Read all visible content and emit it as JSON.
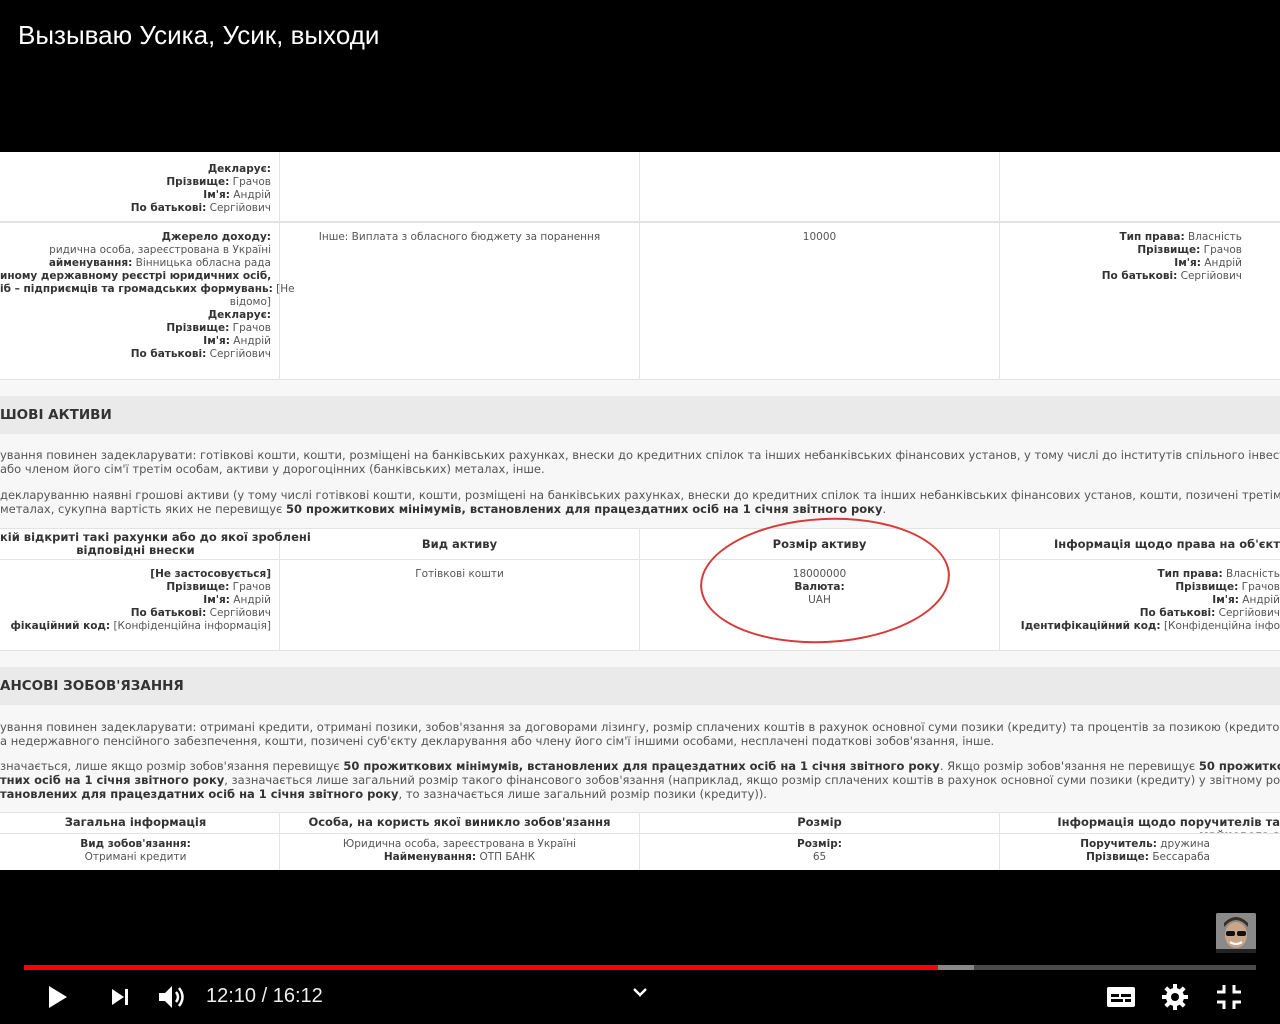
{
  "video": {
    "title": "Вызываю Усика, Усик, выходи",
    "current_time": "12:10",
    "separator": "/",
    "duration": "16:12",
    "progress_played": 0.7415,
    "progress_loaded": 0.7715
  },
  "doc": {
    "row1": {
      "c1": [
        "Декларує:",
        "Прізвище: Грачов",
        "Ім'я: Андрій",
        "По батькові: Сергійович"
      ]
    },
    "row2": {
      "c1_lines": [
        {
          "b": "Джерело доходу:",
          "t": ""
        },
        {
          "b": "",
          "t": "ридична особа, зареєстрована в Україні"
        },
        {
          "b": "айменування:",
          "t": " Вінницька обласна рада"
        },
        {
          "b": "иному державному реєстрі юридичних осіб,",
          "t": ""
        },
        {
          "b": "іб – підприємців та громадських формувань:",
          "t": " [Не"
        },
        {
          "b": "",
          "t": "відомо]"
        },
        {
          "b": "",
          "t": " "
        },
        {
          "b": "Декларує:",
          "t": ""
        },
        {
          "b": "Прізвище:",
          "t": " Грачов"
        },
        {
          "b": "Ім'я:",
          "t": " Андрій"
        },
        {
          "b": "По батькові:",
          "t": " Сергійович"
        }
      ],
      "c2": "Інше: Виплата з обласного бюджету за поранення",
      "c3": "10000",
      "c4_lines": [
        {
          "b": "Тип права:",
          "t": " Власність"
        },
        {
          "b": "Прізвище:",
          "t": " Грачов"
        },
        {
          "b": "Ім'я:",
          "t": " Андрій"
        },
        {
          "b": "По батькові:",
          "t": " Сергійович"
        }
      ]
    },
    "section_cash": "ШОВІ АКТИВИ",
    "cash_para": [
      "ування повинен задекларувати: готівкові кошти, кошти, розміщені на банківських рахунках, внески до кредитних спілок та інших небанківських фінансових установ, у тому числі до інститутів спільного інвестування, кошти, поз",
      "або членом його сім'ї третім особам, активи у дорогоцінних (банківських) металах, інше."
    ],
    "cash_para2_a": " декларуванню наявні грошові активи (у тому числі готівкові кошти, кошти, розміщені на банківських рахунках, внески до кредитних спілок та інших небанківських фінансових установ, кошти, позичені третім особам) та активи у",
    "cash_para2_b1": "металах, сукупна вартість яких не перевищує ",
    "cash_para2_b2": "50 прожиткових мінімумів, встановлених для працездатних осіб на 1 січня звітного року",
    "cash_para2_b3": ".",
    "cash_headers": {
      "c1a": "кій відкриті такі рахунки або до якої зроблені",
      "c1b": "відповідні внески",
      "c2": "Вид активу",
      "c3": "Розмір активу",
      "c4": "Інформація щодо права на об'єкт"
    },
    "cash_row": {
      "c1_lines": [
        {
          "b": "[Не застосовується]",
          "t": ""
        },
        {
          "b": "",
          "t": " "
        },
        {
          "b": "Прізвище:",
          "t": " Грачов"
        },
        {
          "b": "Ім'я:",
          "t": " Андрій"
        },
        {
          "b": "По батькові:",
          "t": " Сергійович"
        },
        {
          "b": "фікаційний код:",
          "t": " [Конфіденційна інформація]"
        }
      ],
      "c2": "Готівкові кошти",
      "c3_value": "18000000",
      "c3_currency_label": "Валюта:",
      "c3_currency": "UAH",
      "c4_lines": [
        {
          "b": "Тип права:",
          "t": " Власність"
        },
        {
          "b": "Прізвище:",
          "t": " Грачов"
        },
        {
          "b": "Ім'я:",
          "t": " Андрій"
        },
        {
          "b": "По батькові:",
          "t": " Сергійович"
        },
        {
          "b": "Ідентифікаційний код:",
          "t": " [Конфіденційна інфо"
        }
      ]
    },
    "section_liab": "АНСОВІ ЗОБОВ'ЯЗАННЯ",
    "liab_para": [
      "ування повинен задекларувати: отримані кредити, отримані позики, зобов'язання за договорами лізингу, розмір сплачених коштів в рахунок основної суми позики (кредиту) та процентів за позикою (кредитом), зобов'язання за д",
      "а недержавного пенсійного забезпечення, кошти, позичені суб'єкту декларування або члену його сім'ї іншими особами, несплачені податкові зобов'язання, інше."
    ],
    "liab_p2": [
      {
        "t": "значається, лише якщо розмір зобов'язання перевищує ",
        "b": "50 прожиткових мінімумів, встановлених для працездатних осіб на 1 січня звітного року",
        "t2": ". Якщо розмір зобов'язання не перевищує ",
        "b2": "50 прожиткових мінімумів"
      },
      {
        "t": "",
        "b": "тних осіб на 1 січня звітного року",
        "t2": ", зазначається лише загальний розмір такого фінансового зобов'язання (наприклад, якщо розмір сплачених коштів в рахунок основної суми позики (кредиту) у звітному році не перевищує ",
        "b2": "50"
      },
      {
        "t": "",
        "b": "тановлених для працездатних осіб на 1 січня звітного року",
        "t2": ", то зазначається лише загальний розмір позики (кредиту)).",
        "b2": ""
      }
    ],
    "liab_headers": {
      "c1": "Загальна інформація",
      "c2": "Особа, на користь якої виникло зобов'язання",
      "c3": "Розмір",
      "c4": "Інформація щодо поручителів та майнового з"
    },
    "liab_row": {
      "c1_label": "Вид зобов'язання:",
      "c1_value": "Отримані кредити",
      "c2_line1": "Юридична особа, зареєстрована в Україні",
      "c2_label": "Найменування:",
      "c2_value": " ОТП БАНК",
      "c3_label": "Розмір:",
      "c3_value": "65",
      "c4_label1": "Поручитель:",
      "c4_value1": " дружина",
      "c4_label2": "Прізвище:",
      "c4_value2": " Бессараба"
    }
  },
  "icons": {
    "play": "play-icon",
    "next": "next-icon",
    "volume": "volume-icon",
    "chevron": "chevron-down-icon",
    "subtitles": "subtitles-icon",
    "settings": "gear-icon",
    "fullscreen": "exit-fullscreen-icon"
  }
}
